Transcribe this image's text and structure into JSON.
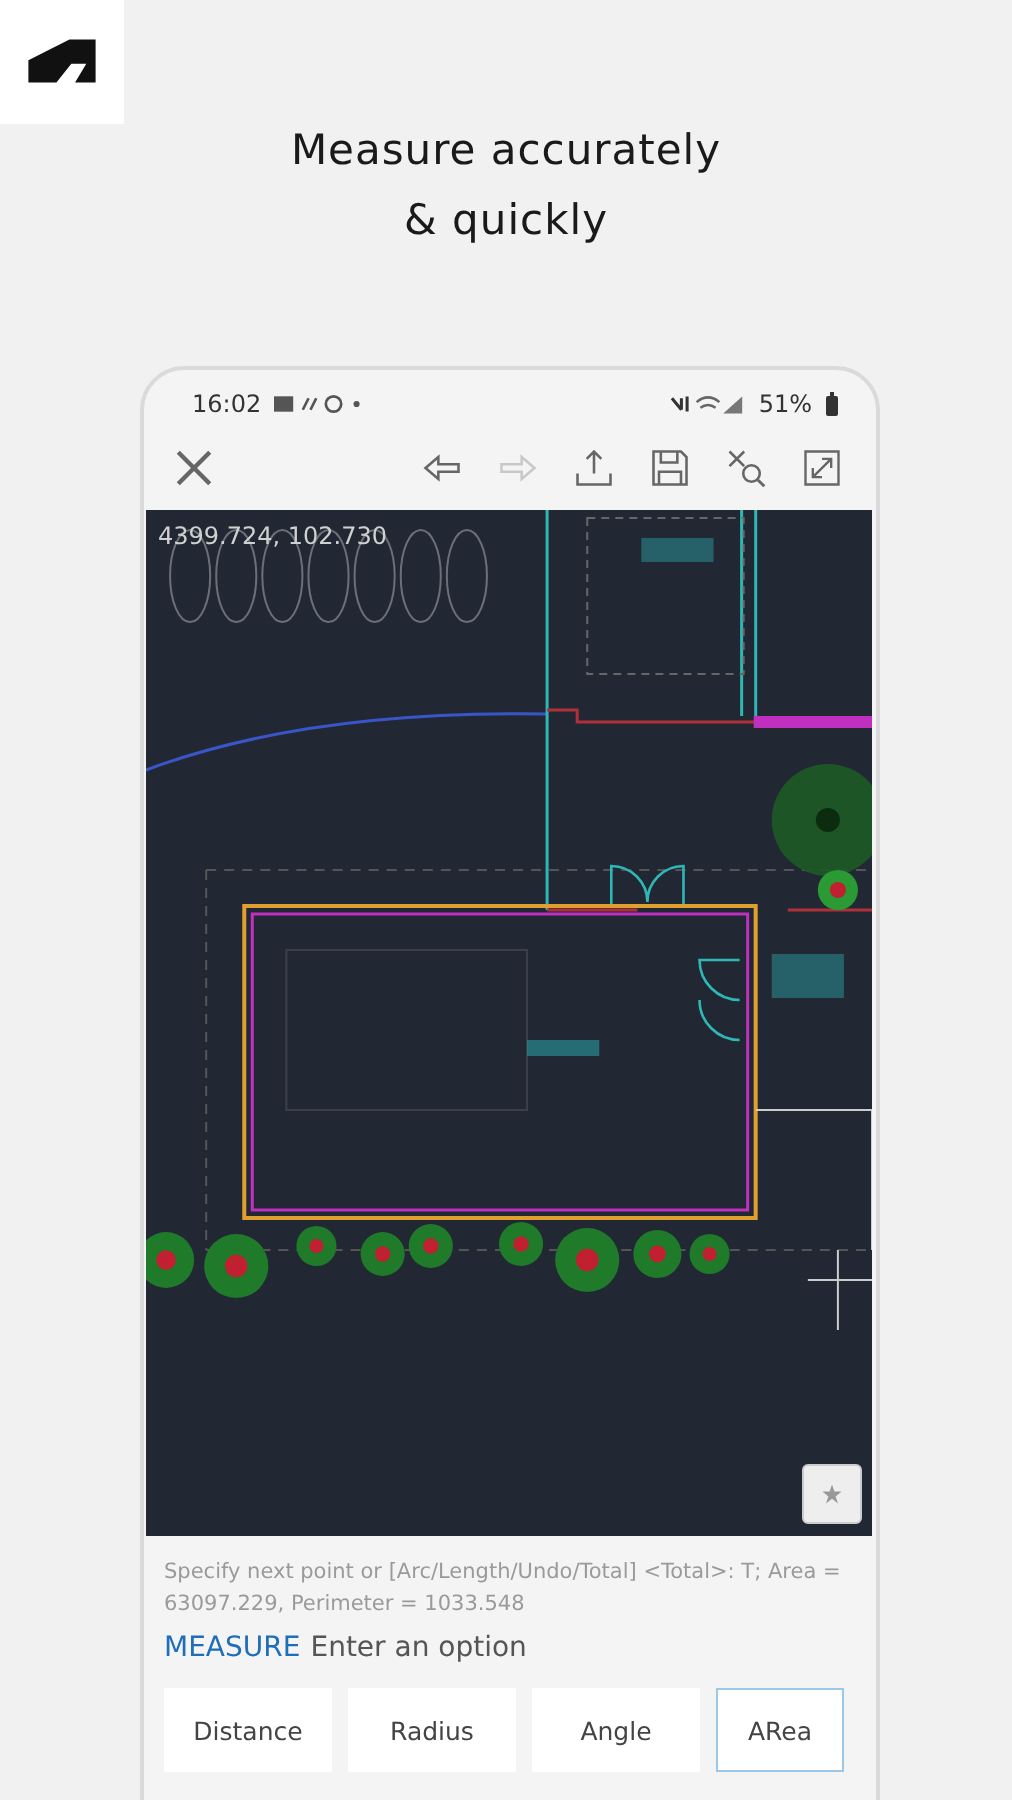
{
  "headline": [
    "Measure accurately",
    "& quickly"
  ],
  "status_bar": {
    "time": "16:02",
    "battery": "51%"
  },
  "toolbar": [
    {
      "kind": "undo",
      "disabled": false
    },
    {
      "kind": "redo",
      "disabled": true
    },
    {
      "kind": "share",
      "disabled": false
    },
    {
      "kind": "save",
      "disabled": false
    },
    {
      "kind": "measure",
      "disabled": false
    },
    {
      "kind": "expand",
      "disabled": false
    }
  ],
  "canvas": {
    "coordinates": "4399.724, 102.730"
  },
  "command_line": {
    "history": "Specify next point or [Arc/Length/Undo/Total] <Total>: T; Area = 63097.229, Perimeter = 1033.548",
    "command": "MEASURE",
    "prompt": "Enter an option"
  },
  "options": [
    {
      "label": "Distance",
      "selected": false
    },
    {
      "label": "Radius",
      "selected": false
    },
    {
      "label": "Angle",
      "selected": false
    },
    {
      "label": "ARea",
      "selected": true
    }
  ]
}
